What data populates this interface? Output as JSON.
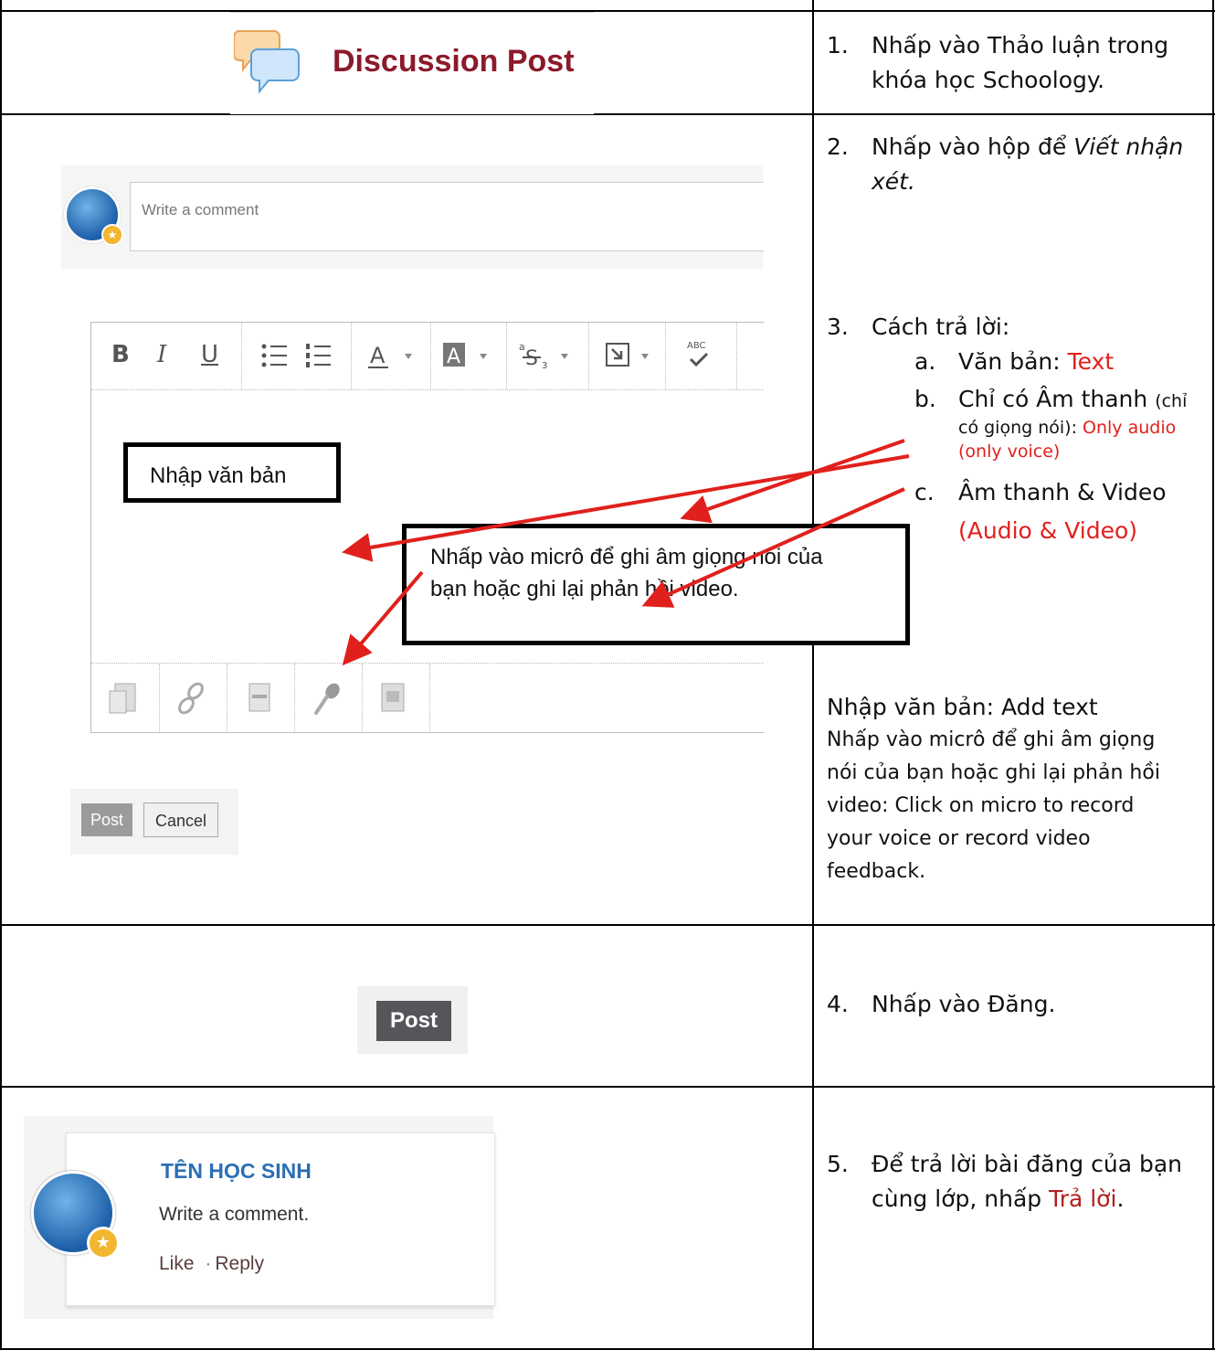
{
  "row1": {
    "header_title": "Discussion Post",
    "step_number": "1.",
    "step_text_line1": "Nhấp vào Thảo luận trong",
    "step_text_line2": "khóa học Schoology."
  },
  "row2": {
    "comment_placeholder": "Write a comment",
    "toolbar": {
      "bold": "B",
      "italic": "I",
      "underline": "U",
      "spellcheck_small": "ABC"
    },
    "callout_text_input": "Nhập văn bản",
    "callout_mic_line1": "Nhấp vào micrô để ghi âm giọng nói của",
    "callout_mic_line2": "bạn hoặc ghi lại phản hồi video.",
    "post_button": "Post",
    "cancel_button": "Cancel",
    "step2_number": "2.",
    "step2_text_a": "Nhấp vào hộp để ",
    "step2_text_italic1": "Viết nhận",
    "step2_text_italic2": "xét.",
    "step3_number": "3.",
    "step3_title": "Cách trả lời:",
    "step3a_label": "a.",
    "step3a_text": "Văn bản: ",
    "step3a_red": "Text",
    "step3b_label": "b.",
    "step3b_text": "Chỉ có Âm thanh ",
    "step3b_small": "(chỉ",
    "step3b_small2": "có giọng nói): ",
    "step3b_red1": "Only audio",
    "step3b_red2": "(only voice)",
    "step3c_label": "c.",
    "step3c_text": "Âm thanh & Video",
    "step3c_red": "(Audio & Video)",
    "note_line1": "Nhập văn bản: Add text",
    "note_line2": "Nhấp vào micrô để ghi âm giọng",
    "note_line3": "nói của bạn hoặc ghi lại phản hồi",
    "note_line4": "video: Click on micro to record",
    "note_line5": "your voice or record video",
    "note_line6": "feedback."
  },
  "row3": {
    "post_button": "Post",
    "step_number": "4.",
    "step_text": "Nhấp vào Đăng."
  },
  "row4": {
    "student_name": "TÊN HỌC SINH",
    "comment_text": "Write a comment.",
    "like_link": "Like",
    "separator": "·",
    "reply_link": "Reply",
    "step_number": "5.",
    "step_text_line1": "Để trả lời bài đăng của bạn",
    "step_text_line2a": "cùng lớp, nhấp ",
    "step_text_red": "Trả lời",
    "step_text_end": "."
  },
  "colors": {
    "title_color": "#8b1a2b",
    "link_blue": "#2a6fb5",
    "arrow_red": "#e0201c",
    "post_bg": "#55565a"
  }
}
